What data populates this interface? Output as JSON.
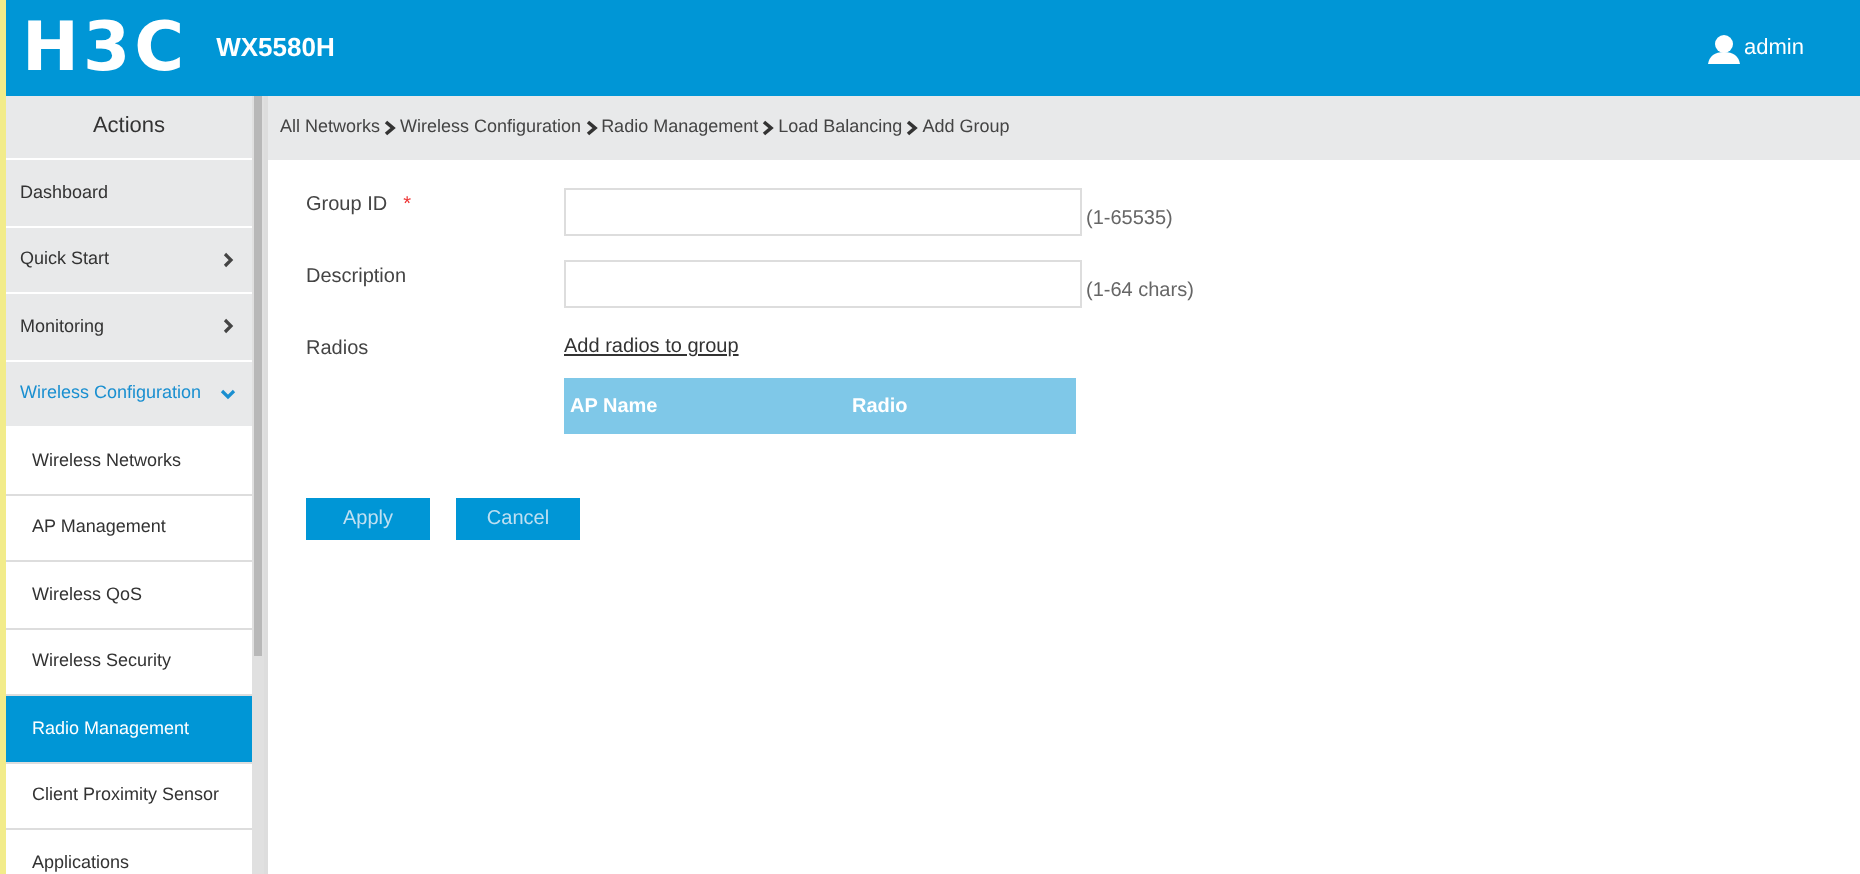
{
  "header": {
    "logo": "H3C",
    "model": "WX5580H",
    "user": "admin"
  },
  "sidebar": {
    "title": "Actions",
    "items": [
      {
        "label": "Dashboard",
        "kind": "link",
        "selected": false
      },
      {
        "label": "Quick Start",
        "kind": "group",
        "expanded": false,
        "selected": false
      },
      {
        "label": "Monitoring",
        "kind": "group",
        "expanded": false,
        "selected": false
      },
      {
        "label": "Wireless Configuration",
        "kind": "group",
        "expanded": true,
        "selected": false,
        "children": [
          {
            "label": "Wireless Networks",
            "selected": false
          },
          {
            "label": "AP Management",
            "selected": false
          },
          {
            "label": "Wireless QoS",
            "selected": false
          },
          {
            "label": "Wireless Security",
            "selected": false
          },
          {
            "label": "Radio Management",
            "selected": true
          },
          {
            "label": "Client Proximity Sensor",
            "selected": false
          },
          {
            "label": "Applications",
            "selected": false
          }
        ]
      }
    ]
  },
  "breadcrumb": [
    "All Networks",
    "Wireless Configuration",
    "Radio Management",
    "Load Balancing",
    "Add Group"
  ],
  "form": {
    "fields": [
      {
        "label": "Group ID",
        "required_mark": "*",
        "hint": "(1-65535)"
      },
      {
        "label": "Description",
        "hint": "(1-64 chars)"
      }
    ],
    "radios": {
      "label": "Radios",
      "link": "Add radios to group",
      "columns": [
        "AP Name",
        "Radio"
      ]
    }
  },
  "buttons": [
    "Apply",
    "Cancel"
  ]
}
